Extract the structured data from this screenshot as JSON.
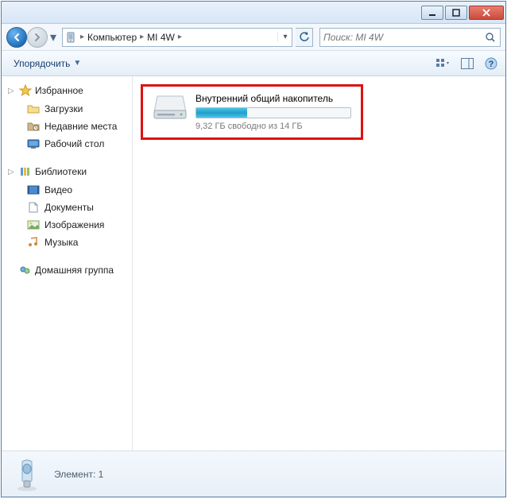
{
  "window": {
    "titlebar": {}
  },
  "nav": {
    "breadcrumb": {
      "root_sep": "▸",
      "part1": "Компьютер",
      "sep": "▸",
      "part2": "MI 4W",
      "tail_sep": "▸"
    },
    "search_placeholder": "Поиск: MI 4W"
  },
  "cmdbar": {
    "organize_label": "Упорядочить"
  },
  "sidebar": {
    "favorites_label": "Избранное",
    "favorites": [
      {
        "label": "Загрузки"
      },
      {
        "label": "Недавние места"
      },
      {
        "label": "Рабочий стол"
      }
    ],
    "libraries_label": "Библиотеки",
    "libraries": [
      {
        "label": "Видео"
      },
      {
        "label": "Документы"
      },
      {
        "label": "Изображения"
      },
      {
        "label": "Музыка"
      }
    ],
    "homegroup_label": "Домашняя группа"
  },
  "content": {
    "drive": {
      "title": "Внутренний общий накопитель",
      "subtitle": "9,32 ГБ свободно из 14 ГБ",
      "used_percent": 33
    }
  },
  "status": {
    "text": "Элемент: 1"
  }
}
